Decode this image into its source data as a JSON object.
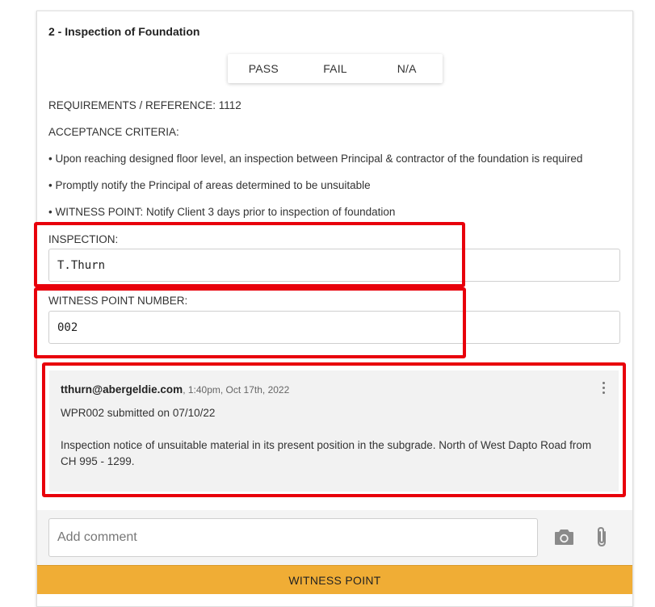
{
  "section": {
    "title": "2 - Inspection of Foundation"
  },
  "result_options": {
    "pass": "PASS",
    "fail": "FAIL",
    "na": "N/A"
  },
  "details": {
    "requirements": "REQUIREMENTS / REFERENCE: 1112",
    "acceptance_heading": "ACCEPTANCE CRITERIA:",
    "criteria": [
      "• Upon reaching designed floor level, an inspection between Principal & contractor of the foundation is required",
      "• Promptly notify the Principal of areas determined to be unsuitable",
      "• WITNESS POINT: Notify Client 3 days prior to inspection of foundation"
    ]
  },
  "fields": {
    "inspection_label": "INSPECTION:",
    "inspection_value": "T.Thurn",
    "witness_point_label": "WITNESS POINT NUMBER:",
    "witness_point_value": "002"
  },
  "comment": {
    "author": "tthurn@abergeldie.com",
    "timestamp": ", 1:40pm, Oct 17th, 2022",
    "line1": "WPR002 submitted on 07/10/22",
    "line2": "Inspection notice of unsuitable material in its present position in the subgrade. North of West Dapto Road from CH 995 - 1299."
  },
  "comment_input": {
    "placeholder": "Add comment"
  },
  "icons": {
    "camera": "camera-icon",
    "attach": "paperclip-icon",
    "menu": "more-vertical-icon"
  },
  "action": {
    "witness_point_label": "WITNESS POINT"
  },
  "colors": {
    "highlight": "#e8000b",
    "action_button": "#f0ad35",
    "comment_background": "#f2f2f2"
  }
}
